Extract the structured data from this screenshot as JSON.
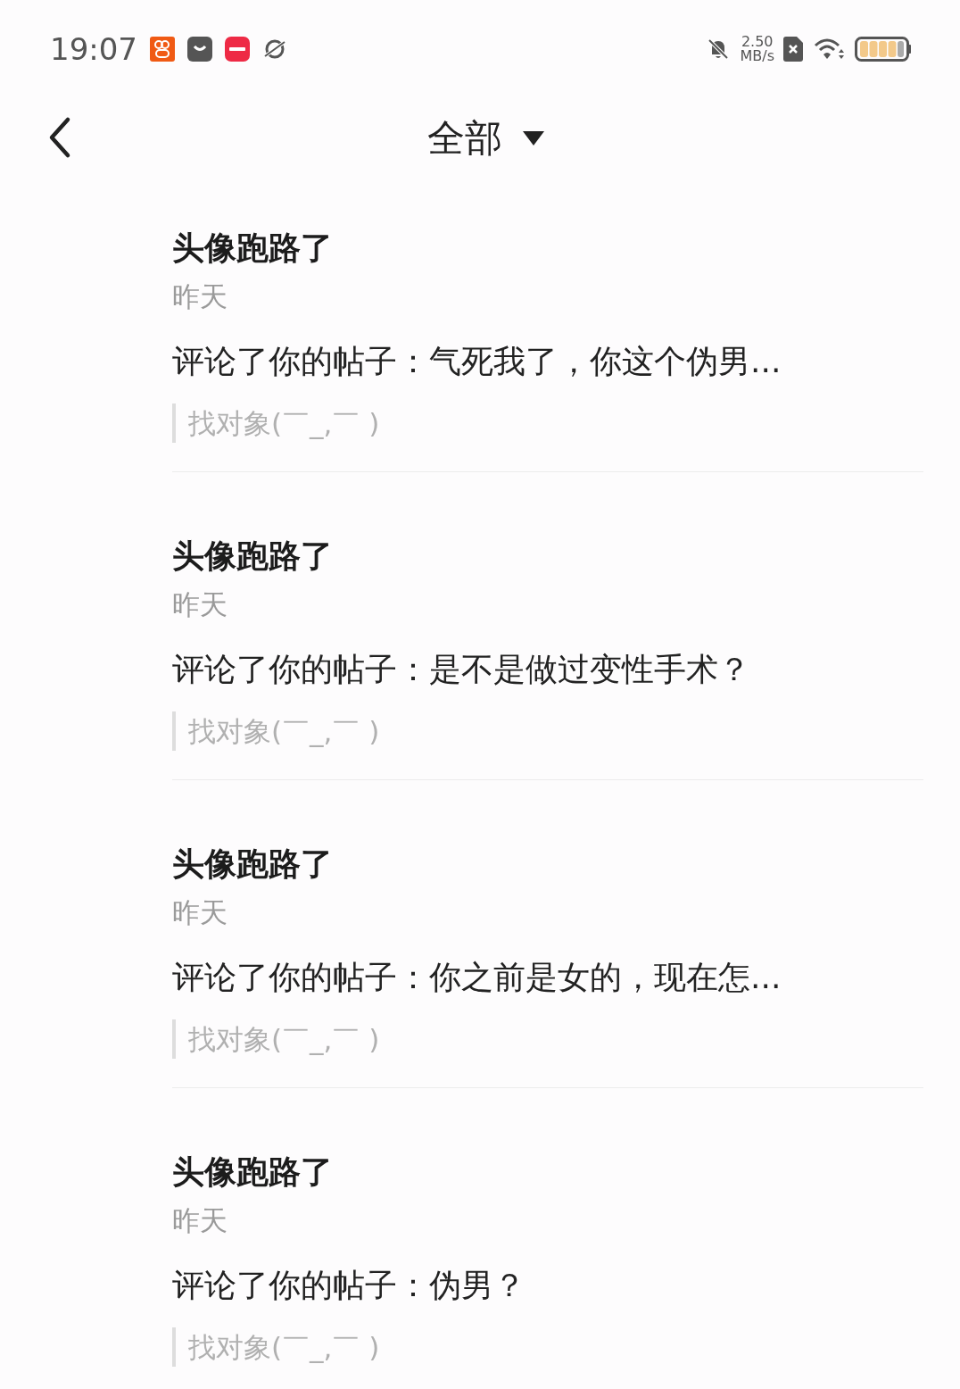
{
  "status_bar": {
    "time": "19:07",
    "speed_value": "2.50",
    "speed_unit": "MB/s"
  },
  "header": {
    "title": "全部"
  },
  "notifications": [
    {
      "user": "头像跑路了",
      "time": "昨天",
      "comment": "评论了你的帖子：气死我了，你这个伪男...",
      "quote": "找对象(￣_,￣ )"
    },
    {
      "user": "头像跑路了",
      "time": "昨天",
      "comment": "评论了你的帖子：是不是做过变性手术？",
      "quote": "找对象(￣_,￣ )"
    },
    {
      "user": "头像跑路了",
      "time": "昨天",
      "comment": "评论了你的帖子：你之前是女的，现在怎...",
      "quote": "找对象(￣_,￣ )"
    },
    {
      "user": "头像跑路了",
      "time": "昨天",
      "comment": "评论了你的帖子：伪男？",
      "quote": "找对象(￣_,￣ )"
    }
  ]
}
